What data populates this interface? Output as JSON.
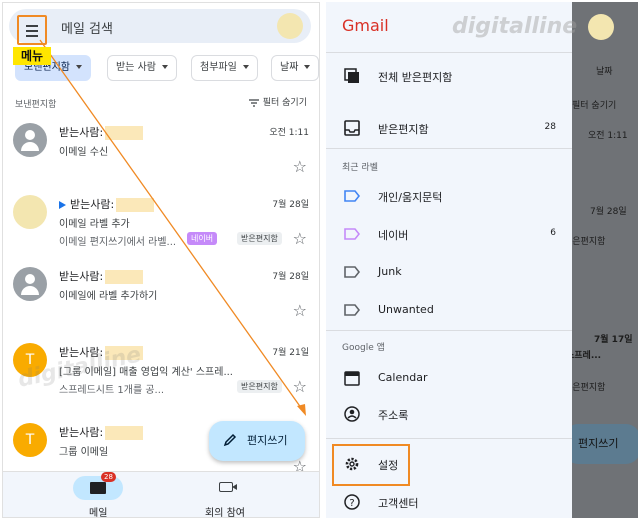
{
  "left": {
    "search_placeholder": "메일 검색",
    "menu_badge": "메뉴",
    "chips": [
      {
        "label": "보낸편지함",
        "selected": true
      },
      {
        "label": "받는 사람",
        "selected": false
      },
      {
        "label": "첨부파일",
        "selected": false
      },
      {
        "label": "날짜",
        "selected": false
      }
    ],
    "folder_label": "보낸편지함",
    "filter_label": "필터 숨기기",
    "mails": [
      {
        "from_prefix": "받는사람:",
        "date": "오전 1:11",
        "line2": "이메일 수신",
        "line3": "",
        "avatar": "gray"
      },
      {
        "from_prefix": "받는사람:",
        "date": "7월 28일",
        "line2": "이메일 라벨 추가",
        "line3": "이메일 편지쓰기에서 라벨...",
        "tag1": "네이버",
        "tag2": "받은편지함",
        "avatar": "cream"
      },
      {
        "from_prefix": "받는사람:",
        "date": "7월 28일",
        "line2": "이메일에 라벨 추가하기",
        "line3": "",
        "avatar": "gray"
      },
      {
        "from_prefix": "받는사람:",
        "date": "7월 21일",
        "line2": "[그룹 이메일] 매출 영업익 계산' 스프레...",
        "line3": "스프레드시트 1개를 공...",
        "tag2": "받은편지함",
        "avatar": "orange",
        "avatar_letter": "T"
      },
      {
        "from_prefix": "받는사람:",
        "date": "",
        "line2": "그룹 이메일",
        "line3": "",
        "avatar": "orange",
        "avatar_letter": "T"
      }
    ],
    "compose_label": "편지쓰기",
    "bottom_nav": {
      "mail_label": "메일",
      "mail_badge": "28",
      "meet_label": "회의 참여"
    },
    "watermark": "digitalline"
  },
  "right": {
    "title": "Gmail",
    "watermark": "digitalline",
    "items_top": [
      {
        "label": "전체 받은편지함",
        "count": "",
        "icon": "all-inbox-icon"
      },
      {
        "label": "받은편지함",
        "count": "28",
        "icon": "inbox-icon"
      }
    ],
    "recent_labels_title": "최근 라벨",
    "labels": [
      {
        "label": "개인/움지문턱",
        "count": "",
        "color": "#4285f4"
      },
      {
        "label": "네이버",
        "count": "6",
        "color": "#c58af9"
      },
      {
        "label": "Junk",
        "count": "",
        "color": "#5f6368"
      },
      {
        "label": "Unwanted",
        "count": "",
        "color": "#5f6368"
      }
    ],
    "google_apps_title": "Google 앱",
    "apps": [
      {
        "label": "Calendar",
        "icon": "calendar-icon"
      },
      {
        "label": "주소록",
        "icon": "contacts-icon"
      }
    ],
    "settings_label": "설정",
    "help_label": "고객센터",
    "behind": {
      "date_chip": "날짜",
      "filter": "필터 숨기기",
      "time": "오전 1:11",
      "date1": "7월 28일",
      "tag1": "받은편지함",
      "tag2": "받은편지함",
      "date2": "7월 17일",
      "snippet": "스프레...",
      "compose": "편지쓰기"
    }
  },
  "colors": {
    "accent_orange": "#f08a24",
    "gmail_red": "#d93025",
    "compose_bg": "#c2e7ff"
  }
}
